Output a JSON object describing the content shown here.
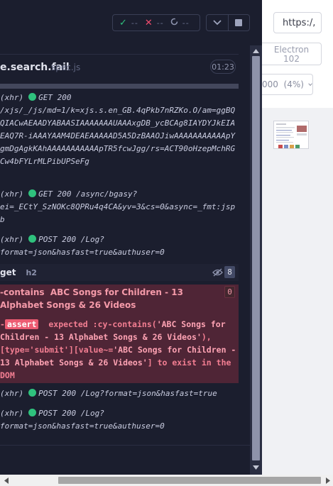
{
  "stats": {
    "passed": "--",
    "failed": "--",
    "pending": "--"
  },
  "spec": {
    "title": "e.search.fail",
    "ext": "spec.js",
    "duration": "01:23"
  },
  "log": {
    "xhr1": {
      "prefix": "(xhr)",
      "method": "GET 200",
      "url": "/xjs/_/js/md=1/k=xjs.s.en_GB.4qPkb7nRZKo.O/am=ggBQQIACwAEAADYABAASIAAAAAAAUAAAxgDB_ycBCAg8IAYDYJkEIAEAQ7R-iAAAYAAM4DEAEAAAAAD5A5DzBAAOJiwAAAAAAAAAAApYgmDgAgkKAhAAAAAAAAAAApTR5fcwJgg/rs=ACT90oHzepMchRGCw4bFYLrMLPibUPSeFg"
    },
    "xhr2": {
      "prefix": "(xhr)",
      "method": "GET 200 /async/bgasy?",
      "url": "ei=_ECtY_SzNOKc8QPRu4q4CA&yv=3&cs=0&async=_fmt:jspb"
    },
    "xhr3": {
      "prefix": "(xhr)",
      "method": "POST 200 /Log?",
      "url": "format=json&hasfast=true&authuser=0"
    },
    "get": {
      "name": "get",
      "message": "h2",
      "count": "8"
    },
    "contains": {
      "prefix": "-contains",
      "text": "ABC Songs for Children - 13 Alphabet Songs & 26 Videos",
      "count": "0"
    },
    "assert": {
      "dash": "-",
      "badge": "assert",
      "part1": "expected",
      "part2": ":cy-contains(",
      "quoted1": "'ABC Songs for Children - 13 Alphabet Songs & 26 Videos'",
      "part3": "),",
      "part4": "[type='submit'][value~=",
      "quoted2": "'ABC Songs for Children - 13 Alphabet Songs & 26 Videos'",
      "part5": "] to exist in the DOM"
    },
    "xhr4": {
      "prefix": "(xhr)",
      "text": "POST 200 /Log?format=json&hasfast=true"
    },
    "xhr5": {
      "prefix": "(xhr)",
      "method": "POST 200 /Log?",
      "url": "format=json&hasfast=true&authuser=0"
    }
  },
  "preview": {
    "url": "https:/,",
    "browser_name": "Electron",
    "browser_version": "102",
    "zoom": "000  (4%)"
  },
  "colors": {
    "pass": "#2fc17d",
    "fail": "#f14c6e",
    "panel_bg": "#1b1e2e",
    "error_bg": "#4f2536"
  }
}
